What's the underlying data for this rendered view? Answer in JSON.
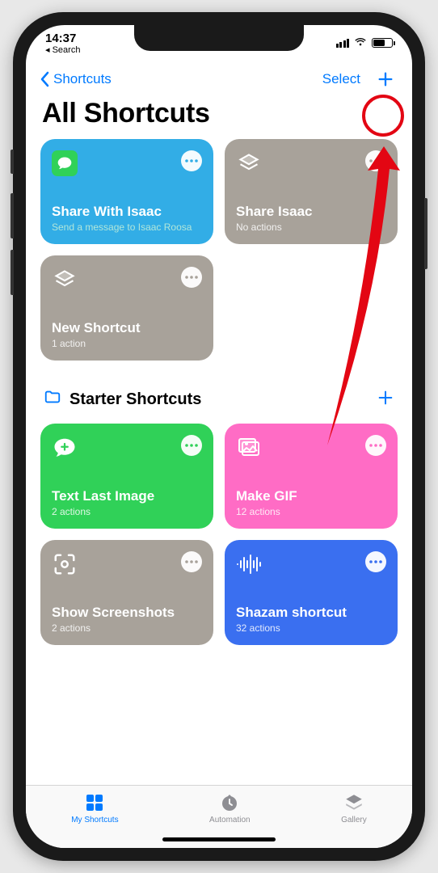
{
  "status": {
    "time": "14:37",
    "backto": "◂ Search"
  },
  "nav": {
    "back_label": "Shortcuts",
    "select_label": "Select"
  },
  "page_title": "All Shortcuts",
  "colors": {
    "blue": "#32ade6",
    "gray": "#a8a29a",
    "green": "#30d158",
    "pink": "#ff6cc5",
    "blue_dark": "#3a6ff0",
    "accent": "#007aff"
  },
  "shortcuts": {
    "items": [
      {
        "title": "Share With Isaac",
        "subtitle": "Send a message to Isaac Roosa",
        "icon": "messages"
      },
      {
        "title": "Share Isaac",
        "subtitle": "No actions",
        "icon": "shortcuts"
      },
      {
        "title": "New Shortcut",
        "subtitle": "1 action",
        "icon": "shortcuts"
      }
    ]
  },
  "folder": {
    "name": "Starter Shortcuts",
    "items": [
      {
        "title": "Text Last Image",
        "subtitle": "2 actions",
        "icon": "message-plus"
      },
      {
        "title": "Make GIF",
        "subtitle": "12 actions",
        "icon": "photos"
      },
      {
        "title": "Show Screenshots",
        "subtitle": "2 actions",
        "icon": "viewfinder"
      },
      {
        "title": "Shazam shortcut",
        "subtitle": "32 actions",
        "icon": "waveform"
      }
    ]
  },
  "tabs": {
    "my_shortcuts": "My Shortcuts",
    "automation": "Automation",
    "gallery": "Gallery"
  }
}
